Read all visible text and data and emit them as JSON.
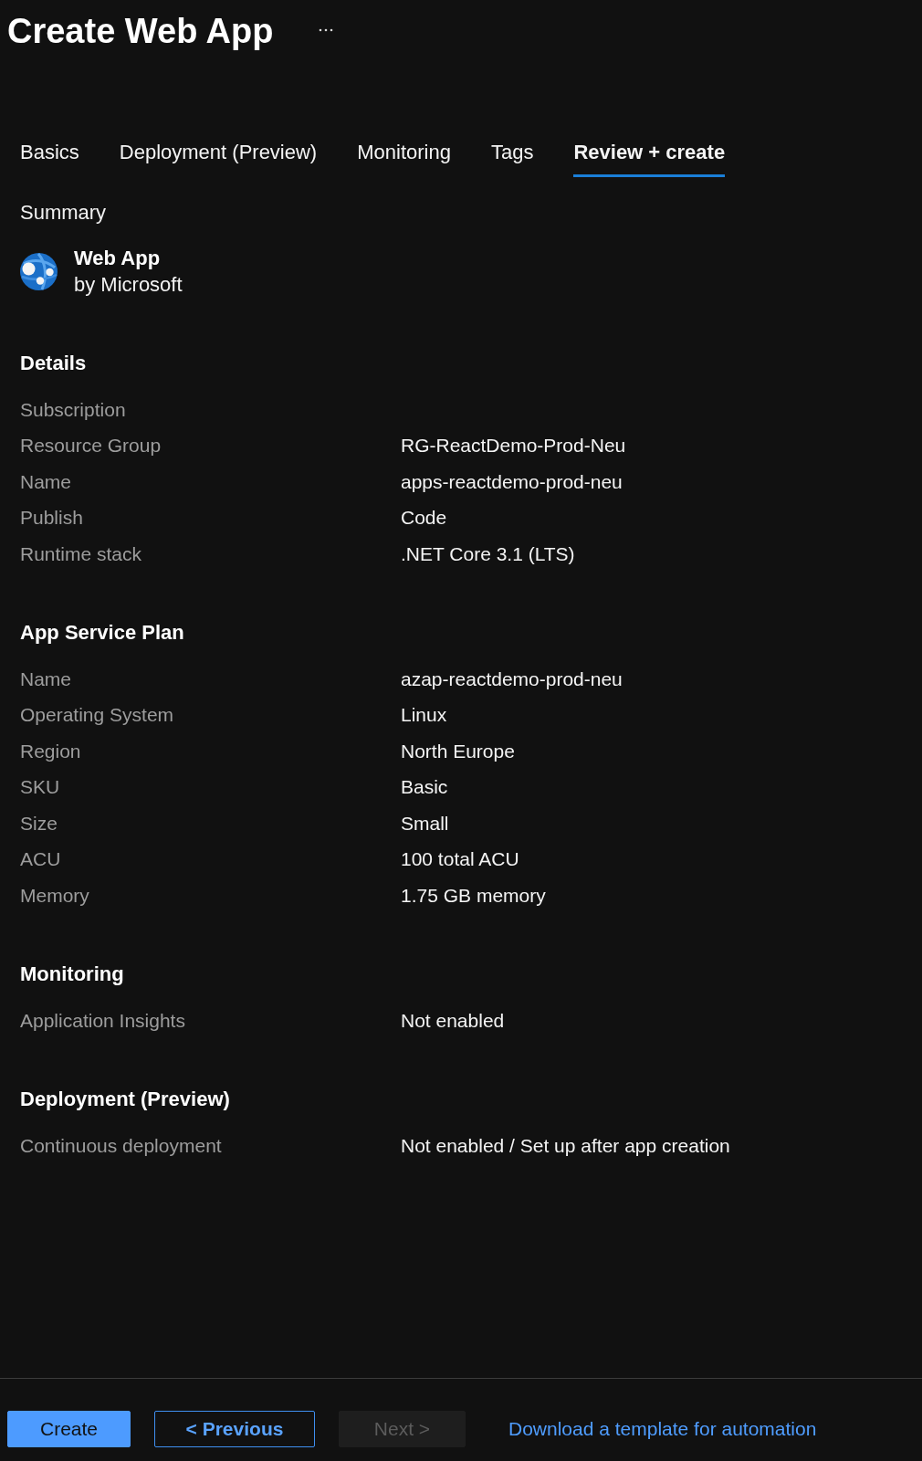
{
  "header": {
    "title": "Create Web App"
  },
  "tabs": [
    {
      "label": "Basics",
      "selected": false
    },
    {
      "label": "Deployment (Preview)",
      "selected": false
    },
    {
      "label": "Monitoring",
      "selected": false
    },
    {
      "label": "Tags",
      "selected": false
    },
    {
      "label": "Review + create",
      "selected": true
    }
  ],
  "summary": {
    "heading": "Summary",
    "product": {
      "name": "Web App",
      "publisher": "by Microsoft"
    }
  },
  "sections": [
    {
      "heading": "Details",
      "rows": [
        {
          "label": "Subscription"
        },
        {
          "label": "Resource Group",
          "value": "RG-ReactDemo-Prod-Neu"
        },
        {
          "label": "Name",
          "value": "apps-reactdemo-prod-neu"
        },
        {
          "label": "Publish",
          "value": "Code"
        },
        {
          "label": "Runtime stack",
          "value": ".NET Core 3.1 (LTS)"
        }
      ]
    },
    {
      "heading": "App Service Plan",
      "rows": [
        {
          "label": "Name",
          "value": "azap-reactdemo-prod-neu"
        },
        {
          "label": "Operating System",
          "value": "Linux"
        },
        {
          "label": "Region",
          "value": "North Europe"
        },
        {
          "label": "SKU",
          "value": "Basic"
        },
        {
          "label": "Size",
          "value": "Small"
        },
        {
          "label": "ACU",
          "value": "100 total ACU"
        },
        {
          "label": "Memory",
          "value": "1.75 GB memory"
        }
      ]
    },
    {
      "heading": "Monitoring",
      "rows": [
        {
          "label": "Application Insights",
          "value": "Not enabled"
        }
      ]
    },
    {
      "heading": "Deployment (Preview)",
      "rows": [
        {
          "label": "Continuous deployment",
          "value": "Not enabled / Set up after app creation"
        }
      ]
    }
  ],
  "footer": {
    "buttons": [
      {
        "label": "Create",
        "kind": "primary",
        "disabled": false
      },
      {
        "label": "< Previous",
        "kind": "secondary",
        "disabled": false
      },
      {
        "label": "Next >",
        "kind": "secondary",
        "disabled": true
      }
    ],
    "link": "Download a template for automation"
  }
}
